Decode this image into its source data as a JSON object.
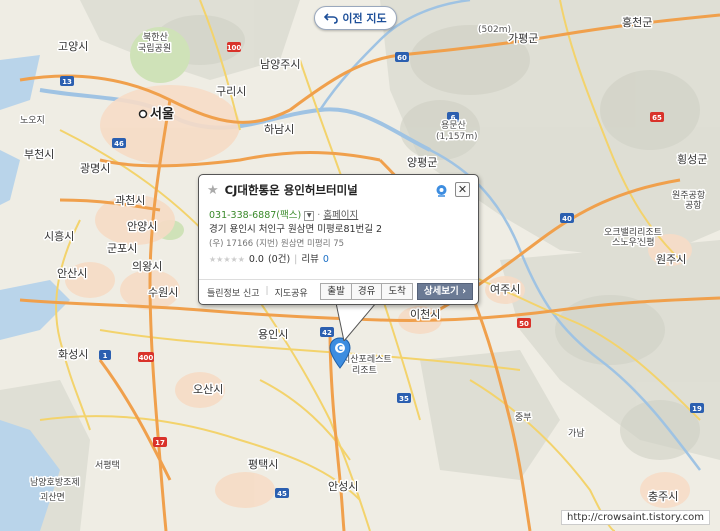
{
  "back_button": {
    "label": "이전 지도"
  },
  "place": {
    "name": "CJ대한통운 용인허브터미널",
    "phone": "031-338-6887(팩스)",
    "homepage": "홈페이지",
    "address": "경기 용인시 처인구 원삼면 미평로81번길 2",
    "postal": "(우) 17166",
    "jibun_label": "(지번)",
    "jibun": "원삼면 미평리 75",
    "rating": "0.0",
    "rating_count": "(0건)",
    "review_label": "리뷰",
    "review_count": "0",
    "report_label": "틀린정보 신고",
    "share_label": "지도공유",
    "buttons": [
      "출발",
      "경유",
      "도착",
      "상세보기 ›"
    ]
  },
  "map_labels": {
    "places": [
      "고양시",
      "북한산",
      "국립공원",
      "남양주시",
      "가평군",
      "홍천군",
      "구리시",
      "서울",
      "노오지",
      "하남시",
      "부천시",
      "광명시",
      "과천시",
      "안양시",
      "시흥시",
      "군포시",
      "의왕시",
      "안산시",
      "수원시",
      "화성시",
      "오산시",
      "용인시",
      "이천시",
      "여주시",
      "원주시",
      "양평군",
      "용문산",
      "(1,157m)",
      "횡성군",
      "원주공항",
      "오크밸리리조트",
      "스노우파크",
      "신평",
      "평택시",
      "서평택",
      "안성시",
      "충주시",
      "가남",
      "중부",
      "지산포레스트",
      "리조트",
      "공항",
      "(502m)",
      "괴산면",
      "남양호방조제"
    ],
    "roads": [
      "100",
      "46",
      "60",
      "6",
      "65",
      "40",
      "50",
      "400",
      "17",
      "1",
      "35",
      "45",
      "19",
      "42",
      "13"
    ]
  },
  "watermark": "http://crowsaint.tistory.com",
  "colors": {
    "accent": "#1d4f99",
    "phone": "#3a8a2a",
    "link": "#1a6fc6",
    "detail_button": "#6b7a94"
  }
}
